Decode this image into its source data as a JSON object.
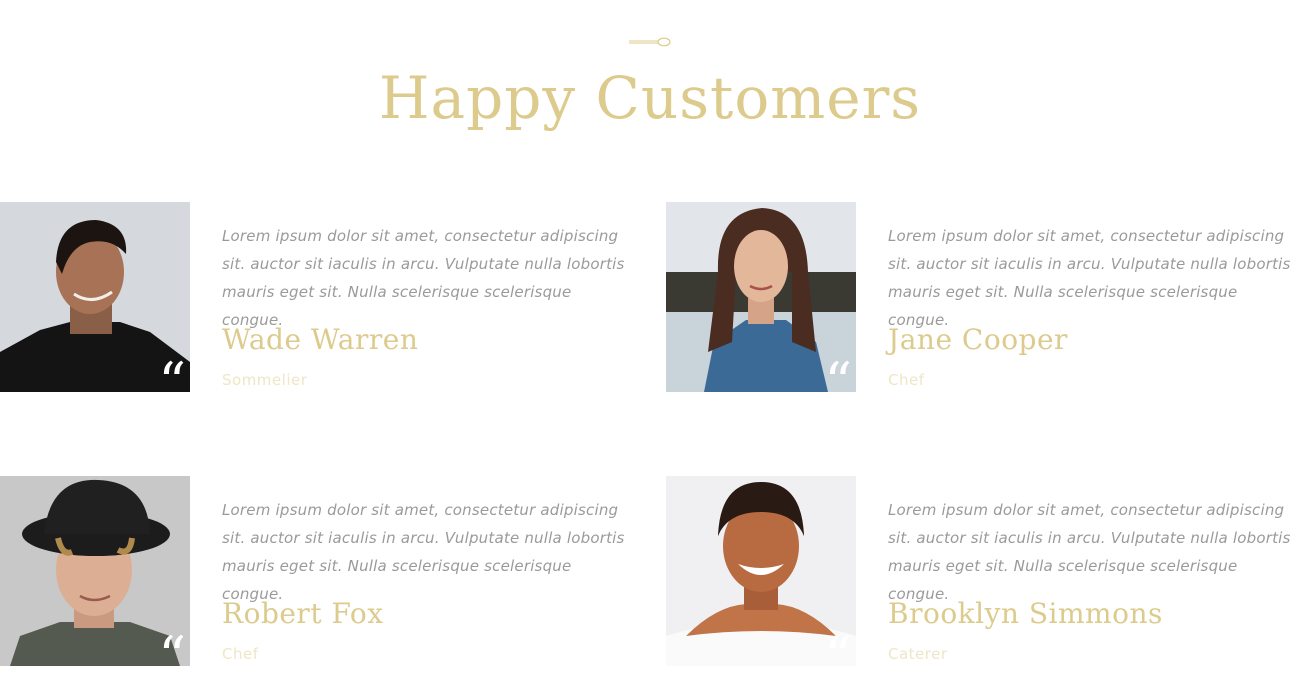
{
  "colors": {
    "accent": "#dccb8c",
    "text_muted": "#9a9a9a",
    "role": "#efe6c6",
    "background": "#ffffff"
  },
  "section": {
    "title": "Happy Customers",
    "ornament_icon": "spoon-icon"
  },
  "testimonials": [
    {
      "quote": "Lorem ipsum dolor sit amet, consectetur adipiscing sit. auctor sit iaculis in arcu. Vulputate nulla lobortis mauris eget sit. Nulla scelerisque scelerisque congue.",
      "name": "Wade Warren",
      "role": "Sommelier",
      "avatar": "portrait-man-dark-hair"
    },
    {
      "quote": "Lorem ipsum dolor sit amet, consectetur adipiscing sit. auctor sit iaculis in arcu. Vulputate nulla lobortis mauris eget sit. Nulla scelerisque scelerisque congue.",
      "name": "Jane Cooper",
      "role": "Chef",
      "avatar": "portrait-woman-denim-jacket"
    },
    {
      "quote": "Lorem ipsum dolor sit amet, consectetur adipiscing sit. auctor sit iaculis in arcu. Vulputate nulla lobortis mauris eget sit. Nulla scelerisque scelerisque congue.",
      "name": "Robert Fox",
      "role": "Chef",
      "avatar": "portrait-man-black-hat"
    },
    {
      "quote": "Lorem ipsum dolor sit amet, consectetur adipiscing sit. auctor sit iaculis in arcu. Vulputate nulla lobortis mauris eget sit. Nulla scelerisque scelerisque congue.",
      "name": "Brooklyn Simmons",
      "role": "Caterer",
      "avatar": "portrait-woman-smiling"
    }
  ]
}
